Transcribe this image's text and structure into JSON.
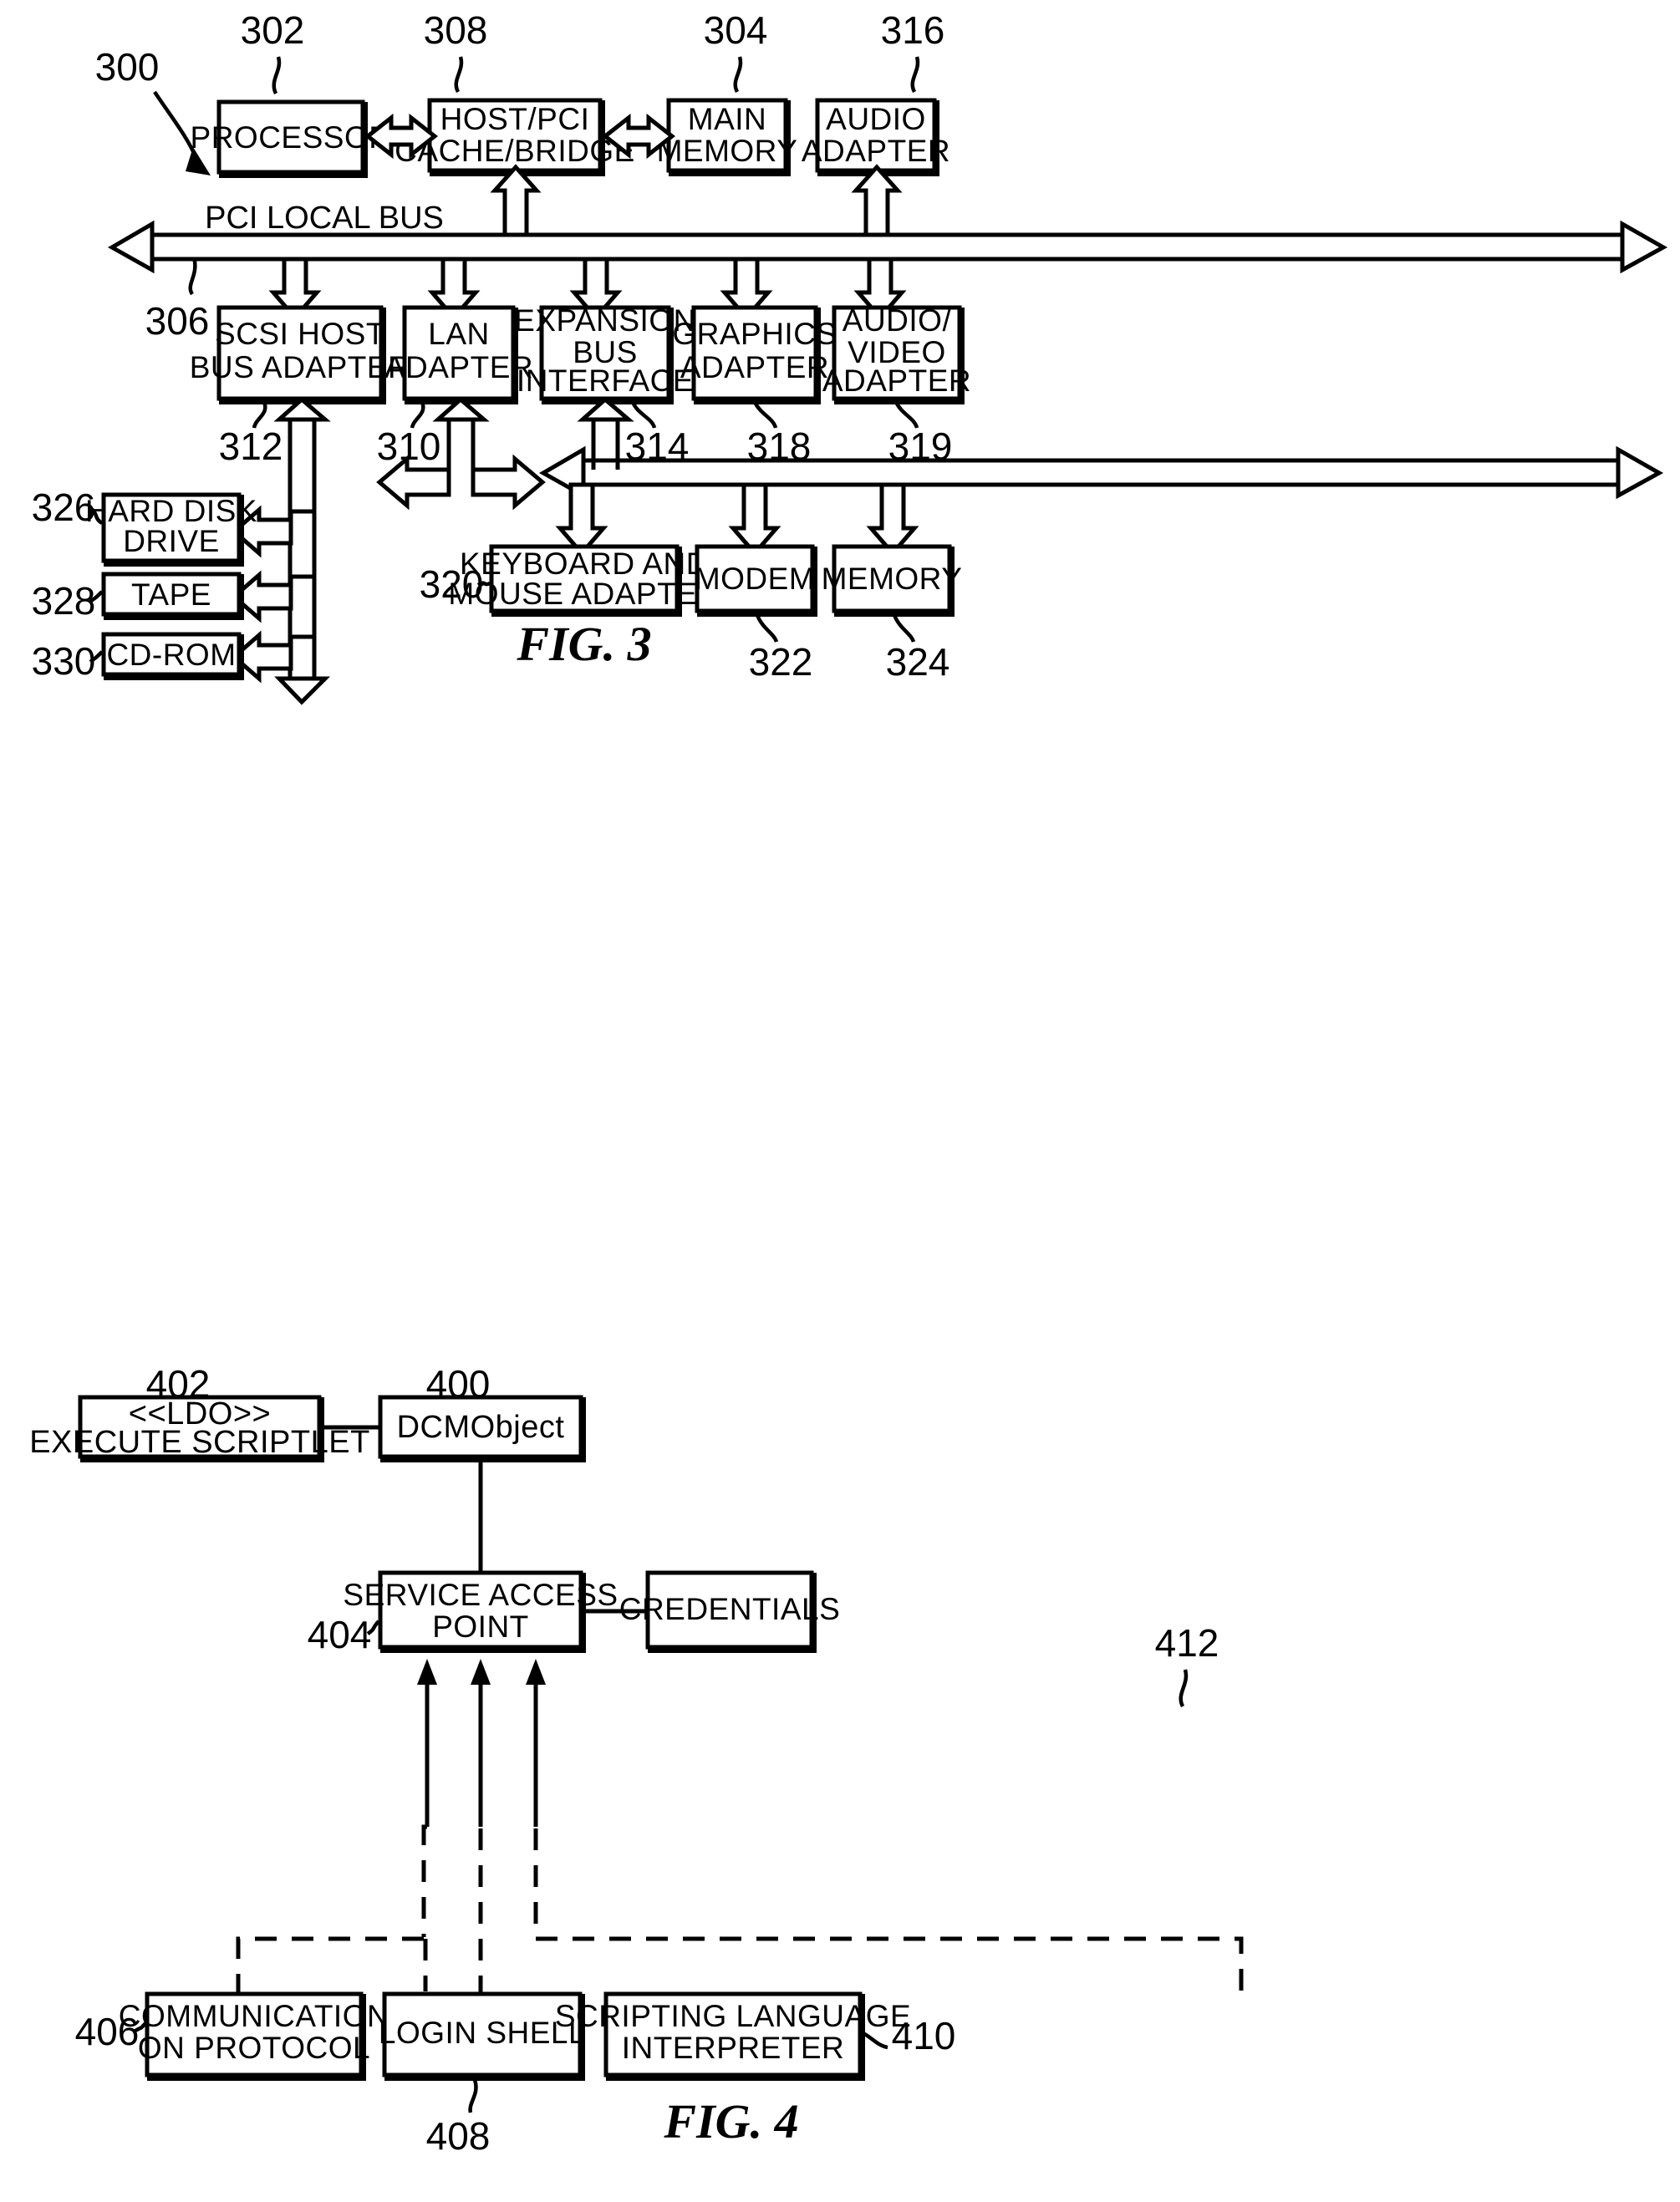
{
  "document": {
    "type": "patent-drawing-sheet",
    "figures": [
      "FIG. 3",
      "FIG. 4"
    ]
  },
  "fig3": {
    "caption": "FIG. 3",
    "system_ref": "300",
    "bus_label": "PCI LOCAL BUS",
    "bus_ref": "306",
    "nodes": [
      {
        "id": "processor",
        "label": "PROCESSOR",
        "ref": "302"
      },
      {
        "id": "host-pci-bridge",
        "label": "HOST/PCI\nCACHE/BRIDGE",
        "ref": "308"
      },
      {
        "id": "main-memory",
        "label": "MAIN\nMEMORY",
        "ref": "304"
      },
      {
        "id": "audio-adapter",
        "label": "AUDIO\nADAPTER",
        "ref": "316"
      },
      {
        "id": "scsi-host-bus-adapter",
        "label": "SCSI HOST\nBUS ADAPTER",
        "ref": "312"
      },
      {
        "id": "lan-adapter",
        "label": "LAN\nADAPTER",
        "ref": "310"
      },
      {
        "id": "expansion-bus-interface",
        "label": "EXPANSION\nBUS\nINTERFACE",
        "ref": "314"
      },
      {
        "id": "graphics-adapter",
        "label": "GRAPHICS\nADAPTER",
        "ref": "318"
      },
      {
        "id": "audio-video-adapter",
        "label": "AUDIO/\nVIDEO\nADAPTER",
        "ref": "319"
      },
      {
        "id": "hard-disk-drive",
        "label": "HARD DISK\nDRIVE",
        "ref": "326"
      },
      {
        "id": "tape",
        "label": "TAPE",
        "ref": "328"
      },
      {
        "id": "cd-rom",
        "label": "CD-ROM",
        "ref": "330"
      },
      {
        "id": "keyboard-mouse-adapter",
        "label": "KEYBOARD AND\nMOUSE ADAPTER",
        "ref": "320"
      },
      {
        "id": "modem",
        "label": "MODEM",
        "ref": "322"
      },
      {
        "id": "memory",
        "label": "MEMORY",
        "ref": "324"
      }
    ],
    "labels": {
      "processor_l1": "PROCESSOR",
      "bridge_l1": "HOST/PCI",
      "bridge_l2": "CACHE/BRIDGE",
      "mainmem_l1": "MAIN",
      "mainmem_l2": "MEMORY",
      "audio_l1": "AUDIO",
      "audio_l2": "ADAPTER",
      "scsi_l1": "SCSI HOST",
      "scsi_l2": "BUS ADAPTER",
      "lan_l1": "LAN",
      "lan_l2": "ADAPTER",
      "exp_l1": "EXPANSION",
      "exp_l2": "BUS",
      "exp_l3": "INTERFACE",
      "gfx_l1": "GRAPHICS",
      "gfx_l2": "ADAPTER",
      "av_l1": "AUDIO/",
      "av_l2": "VIDEO",
      "av_l3": "ADAPTER",
      "hdd_l1": "HARD DISK",
      "hdd_l2": "DRIVE",
      "tape_l1": "TAPE",
      "cdrom_l1": "CD-ROM",
      "kbm_l1": "KEYBOARD AND",
      "kbm_l2": "MOUSE ADAPTER",
      "modem_l1": "MODEM",
      "memory_l1": "MEMORY"
    },
    "refs": {
      "r300": "300",
      "r302": "302",
      "r304": "304",
      "r306": "306",
      "r308": "308",
      "r310": "310",
      "r312": "312",
      "r314": "314",
      "r316": "316",
      "r318": "318",
      "r319": "319",
      "r320": "320",
      "r322": "322",
      "r324": "324",
      "r326": "326",
      "r328": "328",
      "r330": "330"
    }
  },
  "fig4": {
    "caption": "FIG. 4",
    "nodes": [
      {
        "id": "execute-scriptlet",
        "label": "<<LDO>>\nEXECUTE SCRIPTLET",
        "ref": "402"
      },
      {
        "id": "dcmobject",
        "label": "DCMObject",
        "ref": "400"
      },
      {
        "id": "service-access-point",
        "label": "SERVICE ACCESS\nPOINT",
        "ref": "404"
      },
      {
        "id": "credentials",
        "label": "CREDENTIALS",
        "ref": "412"
      },
      {
        "id": "communication-on-protocol",
        "label": "COMMUNICATION\nON PROTOCOL",
        "ref": "406"
      },
      {
        "id": "login-shell",
        "label": "LOGIN SHELL",
        "ref": "408"
      },
      {
        "id": "scripting-language-interpreter",
        "label": "SCRIPTING LANGUAGE\nINTERPRETER",
        "ref": "410"
      }
    ],
    "labels": {
      "ldo_l1": "<<LDO>>",
      "ldo_l2": "EXECUTE SCRIPTLET",
      "dcm_l1": "DCMObject",
      "sap_l1": "SERVICE ACCESS",
      "sap_l2": "POINT",
      "cred_l1": "CREDENTIALS",
      "comm_l1": "COMMUNICATION",
      "comm_l2": "ON PROTOCOL",
      "login_l1": "LOGIN SHELL",
      "script_l1": "SCRIPTING LANGUAGE",
      "script_l2": "INTERPRETER"
    },
    "refs": {
      "r400": "400",
      "r402": "402",
      "r404": "404",
      "r406": "406",
      "r408": "408",
      "r410": "410",
      "r412": "412"
    }
  },
  "colors": {
    "ink": "#000000",
    "paper": "#ffffff"
  }
}
